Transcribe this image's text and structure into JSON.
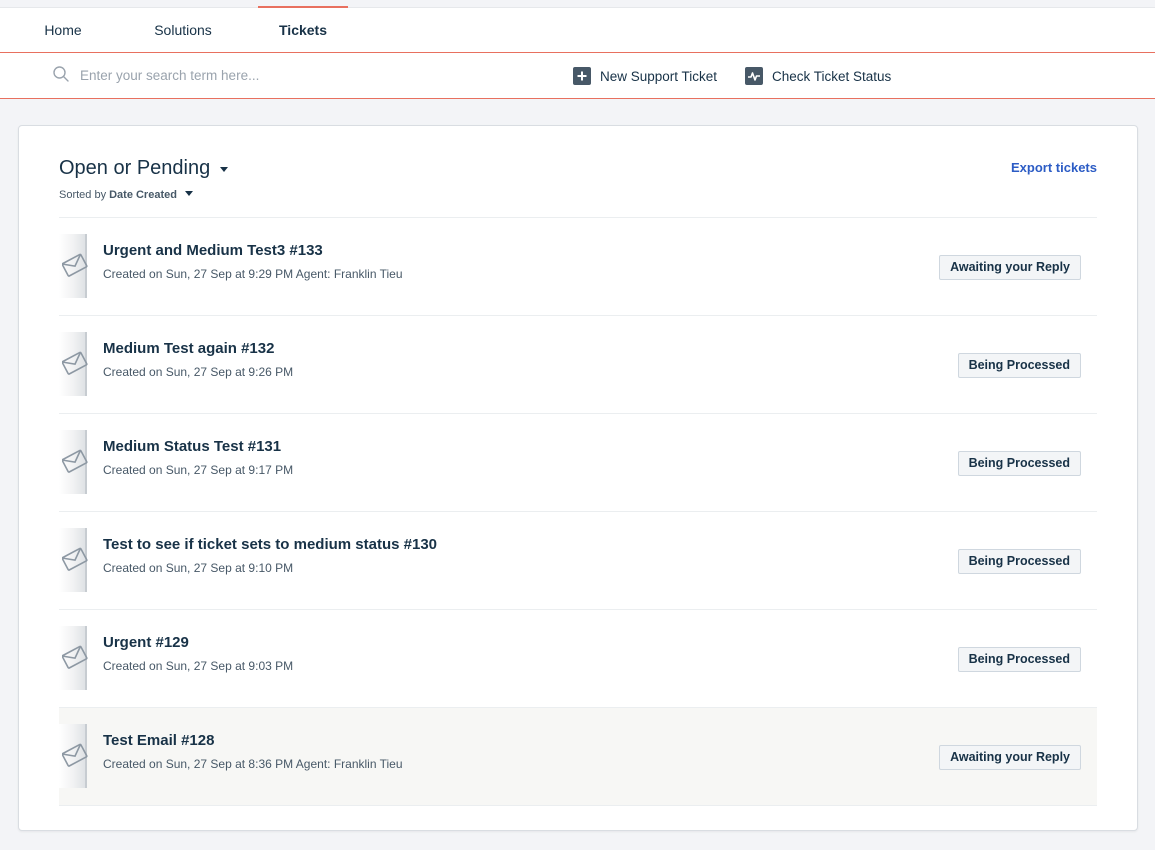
{
  "nav": {
    "tabs": [
      {
        "label": "Home",
        "active": false
      },
      {
        "label": "Solutions",
        "active": false
      },
      {
        "label": "Tickets",
        "active": true
      }
    ]
  },
  "search": {
    "placeholder": "Enter your search term here...",
    "value": ""
  },
  "actions": {
    "new_ticket": {
      "label": "New Support Ticket",
      "icon": "plus-square-icon"
    },
    "check_status": {
      "label": "Check Ticket Status",
      "icon": "pulse-chart-icon"
    }
  },
  "filter": {
    "title": "Open or Pending",
    "sorted_by_label": "Sorted by",
    "sorted_by_value": "Date Created"
  },
  "export_label": "Export tickets",
  "tickets": [
    {
      "subject": "Urgent and Medium Test3 #133",
      "meta": "Created on Sun, 27 Sep at 9:29 PM Agent: Franklin Tieu",
      "status": "Awaiting your Reply"
    },
    {
      "subject": "Medium Test again #132",
      "meta": "Created on Sun, 27 Sep at 9:26 PM",
      "status": "Being Processed"
    },
    {
      "subject": "Medium Status Test #131",
      "meta": "Created on Sun, 27 Sep at 9:17 PM",
      "status": "Being Processed"
    },
    {
      "subject": "Test to see if ticket sets to medium status #130",
      "meta": "Created on Sun, 27 Sep at 9:10 PM",
      "status": "Being Processed"
    },
    {
      "subject": "Urgent #129",
      "meta": "Created on Sun, 27 Sep at 9:03 PM",
      "status": "Being Processed"
    },
    {
      "subject": "Test Email #128",
      "meta": "Created on Sun, 27 Sep at 8:36 PM Agent: Franklin Tieu",
      "status": "Awaiting your Reply"
    }
  ],
  "colors": {
    "accent": "#e8705f",
    "link": "#2c5cc5",
    "text": "#183247",
    "page_bg": "#f3f4f7"
  }
}
